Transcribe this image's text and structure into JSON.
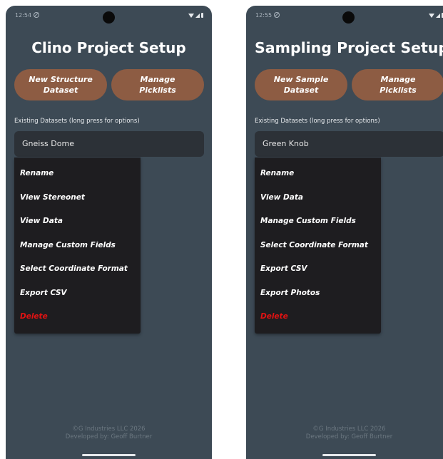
{
  "screens": [
    {
      "status_time": "12:54",
      "title": "Clino Project Setup",
      "buttons": [
        "New Structure\nDataset",
        "Manage\nPicklists"
      ],
      "datasets_label": "Existing Datasets (long press for options)",
      "selected_dataset": "Gneiss Dome",
      "menu": [
        "Rename",
        "View Stereonet",
        "View Data",
        "Manage Custom Fields",
        "Select Coordinate Format",
        "Export CSV",
        "Delete"
      ],
      "footer_line1": "©G Industries LLC 2026",
      "footer_line2": "Developed by: Geoff Burtner"
    },
    {
      "status_time": "12:55",
      "title": "Sampling Project Setup",
      "buttons": [
        "New Sample\nDataset",
        "Manage\nPicklists"
      ],
      "datasets_label": "Existing Datasets (long press for options)",
      "selected_dataset": "Green Knob",
      "menu": [
        "Rename",
        "View Data",
        "Manage Custom Fields",
        "Select Coordinate Format",
        "Export CSV",
        "Export Photos",
        "Delete"
      ],
      "footer_line1": "©G Industries LLC 2026",
      "footer_line2": "Developed by: Geoff Burtner"
    }
  ],
  "colors": {
    "background": "#3d4a55",
    "button": "#8d5c43",
    "menu": "#1e1d20",
    "field": "#2c3137",
    "delete": "#e21212"
  }
}
